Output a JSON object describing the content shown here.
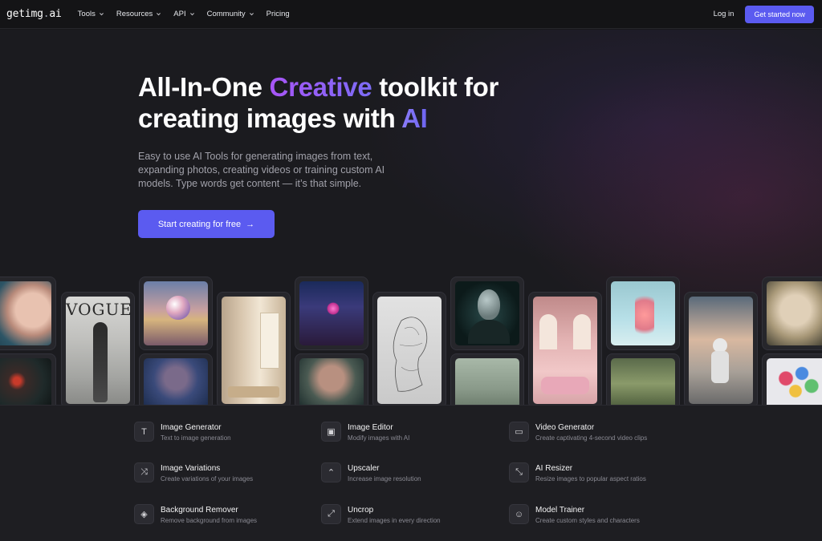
{
  "nav": {
    "logo": "getimg",
    "logo_dot": ".",
    "logo_suffix": "ai",
    "menu": [
      {
        "label": "Tools"
      },
      {
        "label": "Resources"
      },
      {
        "label": "API"
      },
      {
        "label": "Community"
      },
      {
        "label": "Pricing"
      }
    ],
    "login": "Log in",
    "cta": "Get started now"
  },
  "hero": {
    "title_part1": "All-In-One ",
    "title_highlight1": "Creative",
    "title_part2": " toolkit for",
    "title_part3": "creating images with ",
    "title_highlight2": "AI",
    "subtitle": "Easy to use AI Tools for generating images from text, expanding photos, creating videos or training custom AI models. Type words get content — it’s that simple.",
    "cta": "Start creating for free",
    "cta_arrow": "→"
  },
  "gallery": {
    "vogue_text": "VOGUE"
  },
  "features": [
    {
      "title": "Image Generator",
      "desc": "Text to image generation",
      "icon": "T"
    },
    {
      "title": "Image Editor",
      "desc": "Modify images with AI",
      "icon": "▣"
    },
    {
      "title": "Video Generator",
      "desc": "Create captivating 4-second video clips",
      "icon": "▭"
    },
    {
      "title": "Image Variations",
      "desc": "Create variations of your images",
      "icon": "⤨"
    },
    {
      "title": "Upscaler",
      "desc": "Increase image resolution",
      "icon": "⌃"
    },
    {
      "title": "AI Resizer",
      "desc": "Resize images to popular aspect ratios",
      "icon": "⤡"
    },
    {
      "title": "Background Remover",
      "desc": "Remove background from images",
      "icon": "◈"
    },
    {
      "title": "Uncrop",
      "desc": "Extend images in every direction",
      "icon": "⤢"
    },
    {
      "title": "Model Trainer",
      "desc": "Create custom styles and characters",
      "icon": "☺"
    }
  ],
  "colors": {
    "accent": "#5b5bf0",
    "background": "#18181b"
  }
}
